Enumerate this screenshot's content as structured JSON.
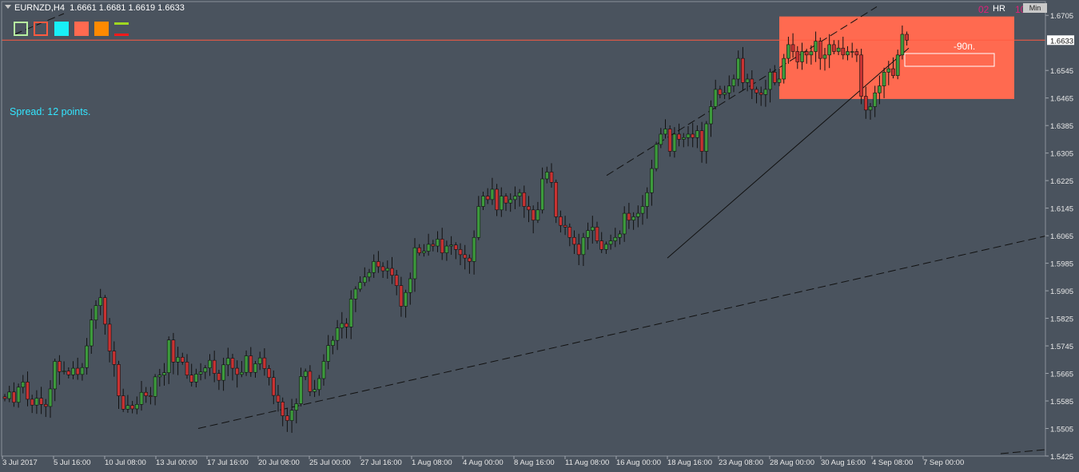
{
  "header": {
    "symbol": "EURNZD,H4",
    "ohlc": "1.6661 1.6681 1.6619 1.6633"
  },
  "spread_text": "Spread: 12 points.",
  "timeframe_panel": {
    "left_number": "02",
    "unit": "HR",
    "right_number": "10",
    "button": "Min"
  },
  "toolbar_colors": [
    "#b7f0a0",
    "#ff5a40",
    "#18f0f8",
    "#ff6a50",
    "#ff8a00",
    "#a0d820"
  ],
  "zone_label": "-90п.",
  "colors": {
    "background": "#4a535e",
    "bull": "#3c9a3c",
    "bear": "#c83232",
    "zone": "#ff6a50",
    "price_line": "#ff5a40"
  },
  "chart_data": {
    "type": "candlestick",
    "symbol": "EURNZD",
    "timeframe": "H4",
    "current_price": "1.6633",
    "ylim": [
      1.5425,
      1.6745
    ],
    "y_ticks": [
      "1.6705",
      "1.6633",
      "1.6545",
      "1.6465",
      "1.6385",
      "1.6305",
      "1.6225",
      "1.6145",
      "1.6065",
      "1.5985",
      "1.5905",
      "1.5825",
      "1.5745",
      "1.5665",
      "1.5585",
      "1.5505",
      "1.5425"
    ],
    "x_ticks": [
      "3 Jul 2017",
      "5 Jul 16:00",
      "10 Jul 08:00",
      "13 Jul 00:00",
      "17 Jul 16:00",
      "20 Jul 08:00",
      "25 Jul 00:00",
      "27 Jul 16:00",
      "1 Aug 08:00",
      "4 Aug 00:00",
      "8 Aug 16:00",
      "11 Aug 08:00",
      "16 Aug 00:00",
      "18 Aug 16:00",
      "23 Aug 08:00",
      "28 Aug 00:00",
      "30 Aug 16:00",
      "4 Sep 08:00",
      "7 Sep 00:00"
    ],
    "closes": [
      1.5592,
      1.5611,
      1.5581,
      1.5625,
      1.564,
      1.559,
      1.5573,
      1.5593,
      1.5575,
      1.5569,
      1.562,
      1.57,
      1.567,
      1.5672,
      1.5661,
      1.568,
      1.5662,
      1.5682,
      1.5745,
      1.582,
      1.5862,
      1.5885,
      1.5808,
      1.573,
      1.5691,
      1.56,
      1.5561,
      1.5572,
      1.5562,
      1.5575,
      1.561,
      1.56,
      1.5598,
      1.5655,
      1.566,
      1.5667,
      1.5762,
      1.5698,
      1.5712,
      1.5698,
      1.566,
      1.564,
      1.5663,
      1.5669,
      1.5681,
      1.5703,
      1.5665,
      1.5645,
      1.569,
      1.5709,
      1.568,
      1.5662,
      1.5668,
      1.5716,
      1.5668,
      1.5693,
      1.571,
      1.5679,
      1.5653,
      1.5601,
      1.5582,
      1.5542,
      1.5528,
      1.5558,
      1.5577,
      1.5656,
      1.5671,
      1.5612,
      1.5618,
      1.565,
      1.57,
      1.5746,
      1.5761,
      1.5797,
      1.581,
      1.58,
      1.5881,
      1.591,
      1.5929,
      1.5945,
      1.5958,
      1.599,
      1.5975,
      1.5963,
      1.597,
      1.595,
      1.592,
      1.586,
      1.59,
      1.594,
      1.603,
      1.6015,
      1.602,
      1.604,
      1.6035,
      1.6055,
      1.6015,
      1.6035,
      1.6038,
      1.6025,
      1.601,
      1.6,
      1.599,
      1.606,
      1.615,
      1.618,
      1.617,
      1.62,
      1.614,
      1.618,
      1.616,
      1.617,
      1.618,
      1.619,
      1.615,
      1.614,
      1.611,
      1.614,
      1.623,
      1.625,
      1.622,
      1.612,
      1.6095,
      1.609,
      1.606,
      1.604,
      1.601,
      1.606,
      1.608,
      1.609,
      1.605,
      1.6025,
      1.604,
      1.605,
      1.606,
      1.607,
      1.613,
      1.611,
      1.612,
      1.613,
      1.615,
      1.619,
      1.626,
      1.633,
      1.636,
      1.6375,
      1.631,
      1.636,
      1.6345,
      1.635,
      1.636,
      1.635,
      1.637,
      1.631,
      1.639,
      1.644,
      1.649,
      1.6475,
      1.648,
      1.65,
      1.652,
      1.658,
      1.651,
      1.652,
      1.649,
      1.648,
      1.6475,
      1.649,
      1.654,
      1.651,
      1.652,
      1.658,
      1.662,
      1.66,
      1.657,
      1.66,
      1.659,
      1.66,
      1.663,
      1.658,
      1.659,
      1.662,
      1.66,
      1.661,
      1.659,
      1.66,
      1.66,
      1.659,
      1.647,
      1.643,
      1.644,
      1.648,
      1.65,
      1.654,
      1.655,
      1.653,
      1.659,
      1.665,
      1.6633
    ],
    "trendlines": [
      {
        "from": [
          "3 Jul 2017",
          1.5505
        ],
        "to": [
          "7 Sep 00:00",
          1.6065
        ],
        "style": "dashed"
      },
      {
        "from": [
          "11 Aug 08:00",
          1.624
        ],
        "to": [
          "30 Aug 16:00",
          1.673
        ],
        "style": "dashed"
      },
      {
        "from": [
          "18 Aug 16:00",
          1.6
        ],
        "to": [
          "30 Aug 16:00",
          1.661
        ],
        "style": "solid"
      }
    ],
    "zone": {
      "from": "28 Aug 00:00",
      "to": "7 Sep 00:00",
      "top": 1.666,
      "bottom": 1.649,
      "label": "-90п."
    },
    "grid": false
  }
}
